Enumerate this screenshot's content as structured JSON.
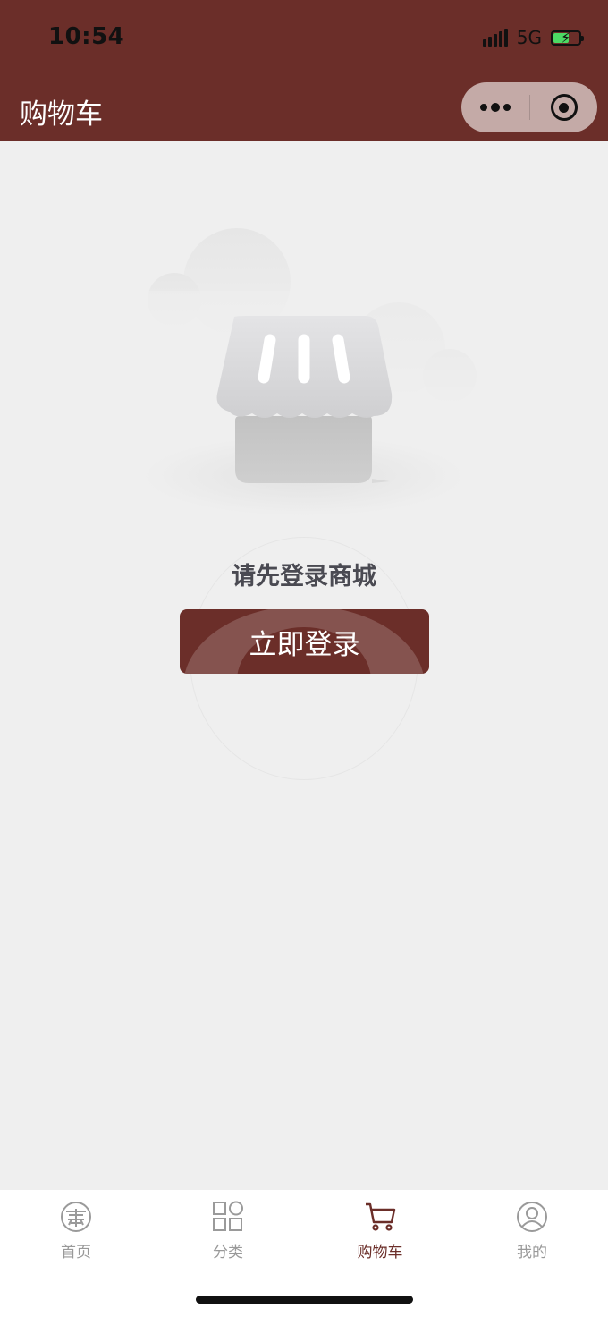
{
  "status_bar": {
    "time": "10:54",
    "network": "5G"
  },
  "header": {
    "title": "购物车"
  },
  "empty_state": {
    "message": "请先登录商城",
    "login_button": "立即登录"
  },
  "tabbar": {
    "items": [
      {
        "label": "首页",
        "icon": "home-icon",
        "active": false
      },
      {
        "label": "分类",
        "icon": "category-grid-icon",
        "active": false
      },
      {
        "label": "购物车",
        "icon": "cart-icon",
        "active": true
      },
      {
        "label": "我的",
        "icon": "user-icon",
        "active": false
      }
    ]
  },
  "colors": {
    "brand": "#6b2e29",
    "background": "#efefef",
    "inactive_tab": "#999999"
  }
}
